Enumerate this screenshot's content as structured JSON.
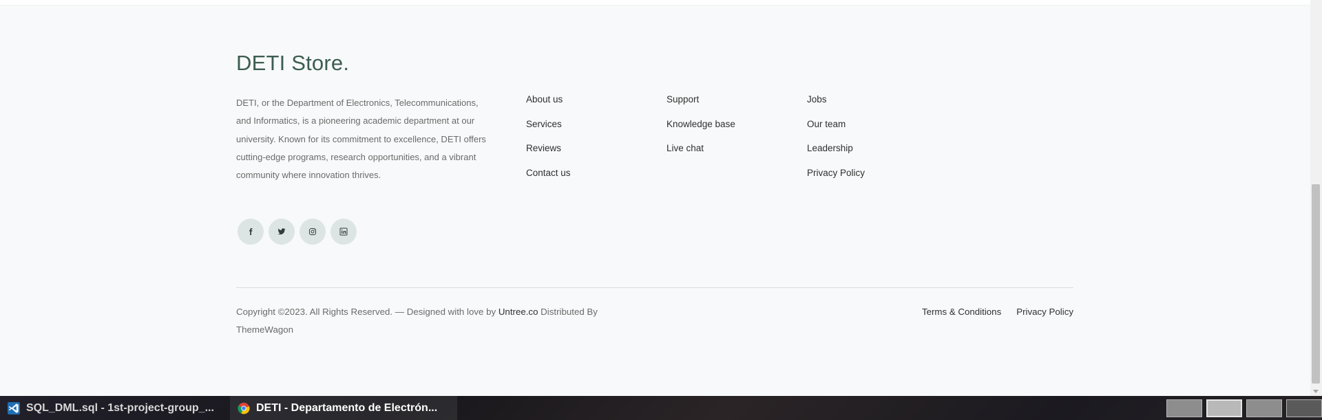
{
  "footer": {
    "brand": "DETI Store.",
    "about_text": "DETI, or the Department of Electronics, Telecommunications, and Informatics, is a pioneering academic department at our university. Known for its commitment to excellence, DETI offers cutting-edge programs, research opportunities, and a vibrant community where innovation thrives.",
    "socials": [
      {
        "icon": "facebook-icon"
      },
      {
        "icon": "twitter-icon"
      },
      {
        "icon": "instagram-icon"
      },
      {
        "icon": "linkedin-icon"
      }
    ],
    "columns": [
      {
        "links": [
          "About us",
          "Services",
          "Reviews",
          "Contact us"
        ]
      },
      {
        "links": [
          "Support",
          "Knowledge base",
          "Live chat"
        ]
      },
      {
        "links": [
          "Jobs",
          "Our team",
          "Leadership",
          "Privacy Policy"
        ]
      }
    ],
    "copyright": {
      "prefix": "Copyright ©2023. All Rights Reserved. — Designed with love by ",
      "designer": "Untree.co",
      "middle": " Distributed By ",
      "distributor": "ThemeWagon"
    },
    "legal_links": [
      "Terms & Conditions",
      "Privacy Policy"
    ]
  },
  "taskbar": {
    "tasks": [
      {
        "label": "SQL_DML.sql - 1st-project-group_...",
        "icon": "vscode-icon"
      },
      {
        "label": "DETI - Departamento de Electrón...",
        "icon": "chrome-icon"
      }
    ],
    "workspaces": 4
  },
  "colors": {
    "brand": "#3b5d50",
    "social_bg": "#dce5e4",
    "text_muted": "#6a6a6a",
    "text_dark": "#2f2f2f"
  }
}
